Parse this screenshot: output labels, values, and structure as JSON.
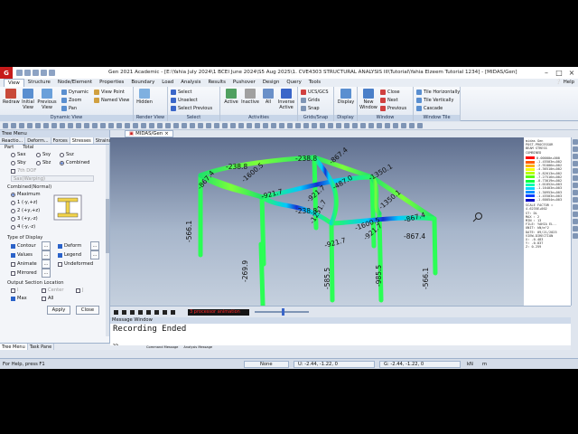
{
  "window": {
    "app_logo": "G",
    "title": "Gen 2021 Academic - [E:\\Yahia July 2024\\1 BCEI June 2024\\S5 Aug 2025\\1. CVE4303 STRUCTURAL ANALYSIS III\\Tutorial\\Yahia Elzeem Tutorial 1234] - [MIDAS/Gen]",
    "minimize": "–",
    "maximize": "□",
    "close": "×"
  },
  "menu": {
    "items": [
      "View",
      "Structure",
      "Node/Element",
      "Properties",
      "Boundary",
      "Load",
      "Analysis",
      "Results",
      "Pushover",
      "Design",
      "Query",
      "Tools"
    ],
    "active": "View",
    "help": "Help"
  },
  "ribbon": {
    "dynamic_view": {
      "label": "Dynamic View",
      "redraw": "Redraw",
      "initial_view": "Initial View",
      "previous_view": "Previous View",
      "dynamic": "Dynamic",
      "zoom": "Zoom",
      "pan": "Pan",
      "view_point": "View Point",
      "named_view": "Named View"
    },
    "render_view": {
      "label": "Render View",
      "hidden": "Hidden"
    },
    "select": {
      "label": "Select",
      "select": "Select",
      "unselect": "Unselect",
      "select_previous": "Select Previous"
    },
    "activities": {
      "label": "Activities",
      "active": "Active",
      "inactive": "Inactive",
      "all": "All",
      "inverse_active": "Inverse Active"
    },
    "grids_snap": {
      "label": "Grids/Snap",
      "ucs_gcs": "UCS/GCS",
      "grids": "Grids",
      "snap": "Snap"
    },
    "display": {
      "label": "Display",
      "display": "Display"
    },
    "window": {
      "label": "Window",
      "new_window": "New Window",
      "close": "Close",
      "next": "Next",
      "previous": "Previous"
    },
    "window_tile": {
      "label": "Window Tile",
      "tile_horizontally": "Tile Horizontally",
      "tile_vertically": "Tile Vertically",
      "cascade": "Cascade"
    }
  },
  "tree_menu": {
    "title": "Tree Menu",
    "tabs": [
      "Reactio...",
      "Deform...",
      "Forces",
      "Stresses",
      "Strains"
    ],
    "active_tab": "Stresses",
    "part_label": "Part",
    "total_label": "Total",
    "components": [
      {
        "label": "Sax",
        "checked": false
      },
      {
        "label": "Ssy",
        "checked": false
      },
      {
        "label": "Ssz",
        "checked": false
      },
      {
        "label": "Sby",
        "checked": false
      },
      {
        "label": "Sbz",
        "checked": false
      },
      {
        "label": "Combined",
        "checked": true
      }
    ],
    "dof_label": "7th DOF",
    "warping_label": "Sax(Warping)",
    "combined_normal_label": "Combined(Normal)",
    "combined_options": [
      {
        "label": "Maximum",
        "checked": true
      },
      {
        "label": "1 (-y,+z)",
        "checked": false
      },
      {
        "label": "2 (+y,+z)",
        "checked": false
      },
      {
        "label": "3 (+y,-z)",
        "checked": false
      },
      {
        "label": "4 (-y,-z)",
        "checked": false
      }
    ],
    "type_of_display_label": "Type of Display",
    "display_options": [
      {
        "label": "Contour",
        "checked": true
      },
      {
        "label": "Deform",
        "checked": true
      },
      {
        "label": "Values",
        "checked": true
      },
      {
        "label": "Legend",
        "checked": true
      },
      {
        "label": "Animate",
        "checked": false
      },
      {
        "label": "Undeformed",
        "checked": false
      },
      {
        "label": "Mirrored",
        "checked": false
      }
    ],
    "more_button": "...",
    "output_section_label": "Output Section Location",
    "output_options": [
      {
        "label": "I",
        "checked": false
      },
      {
        "label": "Center",
        "checked": false
      },
      {
        "label": "J",
        "checked": false
      },
      {
        "label": "Max",
        "checked": true
      },
      {
        "label": "All",
        "checked": false
      }
    ],
    "apply": "Apply",
    "close": "Close",
    "bottom_tabs": [
      "Tree Menu",
      "Task Pane"
    ]
  },
  "doc_tab": "MIDAS/Gen",
  "model_labels": [
    "-238.8",
    "-238.8",
    "-867.4",
    "-867.4",
    "-1600.5",
    "-1350.1",
    "-921.7",
    "-487.0",
    "-921.7",
    "-1350.1",
    "-867.4",
    "-1251.7",
    "-1600.5",
    "-921.7",
    "-921.7",
    "-867.4",
    "-566.1",
    "-269.9",
    "-985.5",
    "-566.1",
    "-585.5",
    "-238.8"
  ],
  "legend": {
    "lines_top": [
      "midas Gen",
      "POST-PROCESSOR",
      "BEAM STRESS",
      "",
      "COMBINED"
    ],
    "values": [
      "0.00000e+000",
      "-1.45503e+002",
      "-2.91006e+002",
      "-4.36510e+002",
      "-5.82013e+002",
      "-7.27516e+002",
      "-8.73019e+002",
      "-1.01852e+003",
      "-1.16403e+003",
      "-1.30953e+003",
      "-1.45503e+003",
      "-1.60054e+003"
    ],
    "colors": [
      "#ff0000",
      "#ff5a00",
      "#ffb000",
      "#f5ff00",
      "#b5ff00",
      "#5aff00",
      "#00ff40",
      "#00ffb0",
      "#00d8ff",
      "#0090ff",
      "#0040ff",
      "#0000c0"
    ],
    "lines_bottom": [
      "SCALE FACTOR =",
      "  4.6235E+002",
      "ST: DL",
      "MAX : 2",
      "MIN : 13",
      "FILE: YAHIA EL..",
      "UNIT: kN/m^2",
      "DATE: 09/21/2025",
      "",
      "VIEW-DIRECTION",
      "  X: -0.483",
      "  Y: -0.837",
      "  Z:  0.259"
    ]
  },
  "player": {
    "status": "3 processor animation"
  },
  "message_window": {
    "title": "Message Window",
    "text": "Recording Ended",
    "prompt": ">>",
    "tabs": [
      "Command Message",
      "Analysis Message"
    ]
  },
  "status_bar": {
    "help": "For Help, press F1",
    "none": "None",
    "u": "U: -2.44, -1.22, 0",
    "g": "G: -2.44, -1.22, 0",
    "unit_force": "kN",
    "unit_length": "m"
  }
}
